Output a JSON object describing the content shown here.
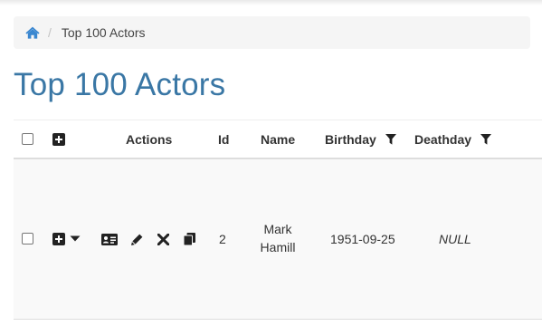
{
  "breadcrumb": {
    "home_icon": "home-icon",
    "separator": "/",
    "current": "Top 100 Actors"
  },
  "page_title": "Top 100 Actors",
  "colors": {
    "title": "#3a77a5",
    "home_icon": "#3a87d0",
    "breadcrumb_bg": "#f5f5f5",
    "row_bg": "#f9f9f9",
    "icon_dark": "#222222"
  },
  "table": {
    "columns": {
      "actions": "Actions",
      "id": "Id",
      "name": "Name",
      "birthday": "Birthday",
      "deathday": "Deathday"
    },
    "rows": [
      {
        "id": "2",
        "name_line1": "Mark",
        "name_line2": "Hamill",
        "birthday": "1951-09-25",
        "deathday": "NULL"
      }
    ]
  }
}
